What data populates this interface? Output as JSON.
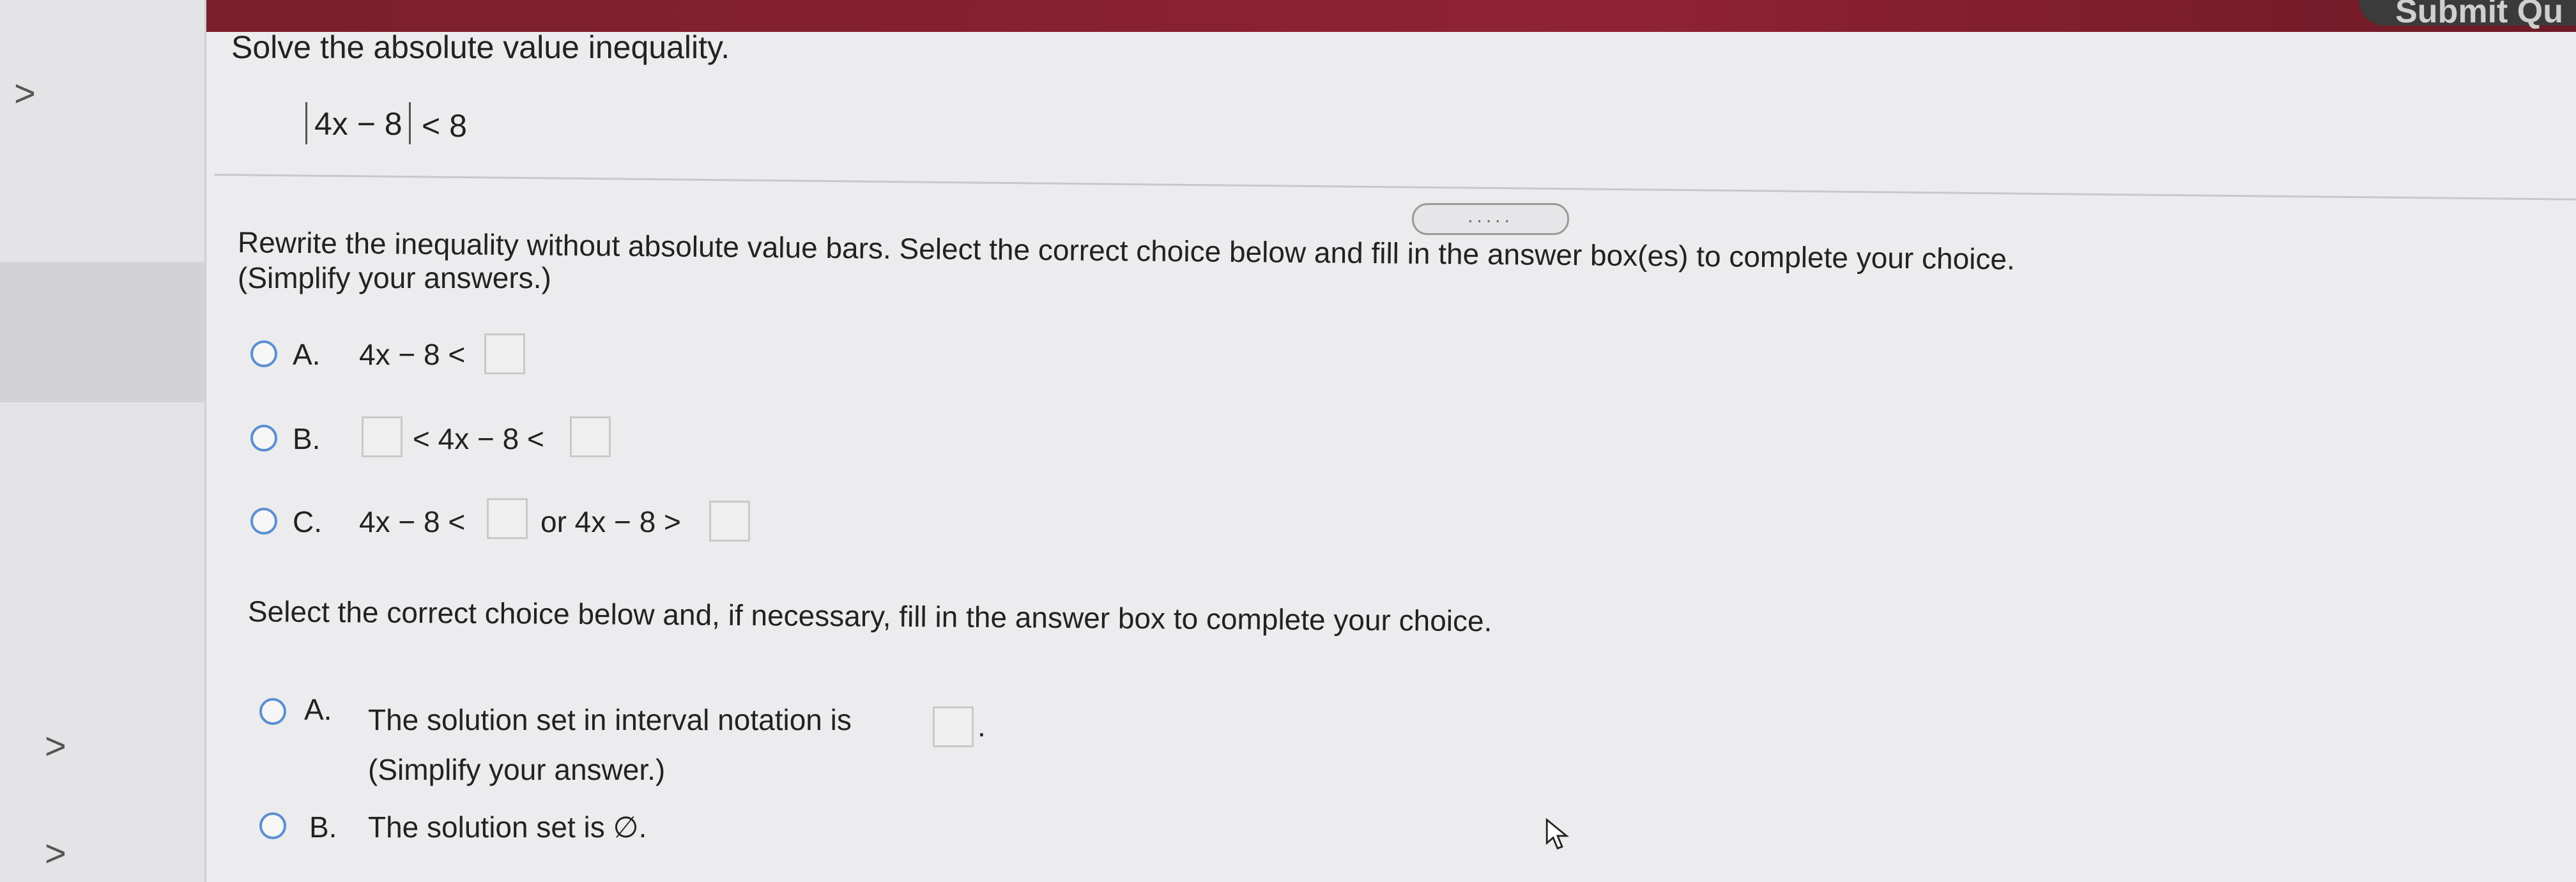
{
  "topbar": {
    "button_label_partial": "Submit Qu"
  },
  "sidebar": {
    "chevrons": [
      ">",
      ">",
      ">"
    ]
  },
  "question": {
    "prompt": "Solve the absolute value inequality.",
    "inequality": {
      "inner": "4x − 8",
      "rhs": "< 8"
    }
  },
  "toolbar": {
    "more_label": "....."
  },
  "part1": {
    "instruction": "Rewrite the inequality without absolute value bars. Select the correct choice below and fill in the answer box(es) to complete your choice.",
    "simplify": "(Simplify your answers.)",
    "choices": [
      {
        "letter": "A.",
        "expr": "4x − 8 <"
      },
      {
        "letter": "B.",
        "expr_mid": "< 4x − 8 <"
      },
      {
        "letter": "C.",
        "expr_left": "4x − 8 <",
        "expr_right": "or 4x − 8 >"
      }
    ]
  },
  "part2": {
    "instruction": "Select the correct choice below and, if necessary, fill in the answer box to complete your choice.",
    "choices": [
      {
        "letter": "A.",
        "text": "The solution set in interval notation is",
        "suffix": ".",
        "note": "(Simplify your answer.)"
      },
      {
        "letter": "B.",
        "text": "The solution set is ∅."
      }
    ]
  },
  "colors": {
    "accent_bar": "#8e2233",
    "radio": "#5b8fd1"
  }
}
